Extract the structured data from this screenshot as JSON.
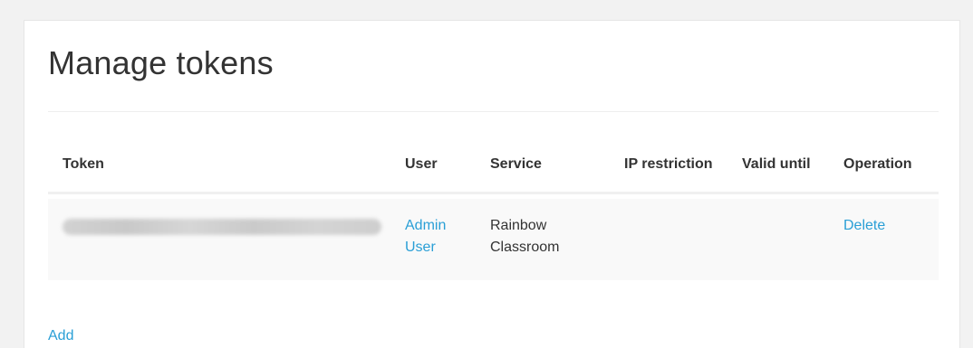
{
  "page": {
    "title": "Manage tokens"
  },
  "table": {
    "headers": {
      "token": "Token",
      "user": "User",
      "service": "Service",
      "ip_restriction": "IP restriction",
      "valid_until": "Valid until",
      "operation": "Operation"
    },
    "rows": [
      {
        "token": "",
        "user": "Admin User",
        "service": "Rainbow Classroom",
        "ip_restriction": "",
        "valid_until": "",
        "operation": "Delete"
      }
    ]
  },
  "actions": {
    "add_label": "Add"
  },
  "colors": {
    "link": "#2a9fd6",
    "text": "#333333",
    "row_background": "#f9f9f9",
    "page_background": "#f2f2f2"
  }
}
